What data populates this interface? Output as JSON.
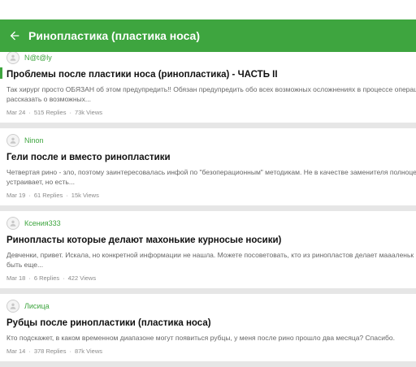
{
  "appbar": {
    "title": "Ринопластика (пластика носа)"
  },
  "posts": [
    {
      "author": "N@t@ly",
      "title": "Проблемы после пластики носа (ринопластика) - ЧАСТЬ II",
      "excerpt_line1": "Так хирург просто ОБЯЗАН об этом предупредить!! Обязан предупредить обо всех возможных осложнениях в процессе операц",
      "excerpt_line2": "рассказать о возможных...",
      "date": "Mar 24",
      "replies": "515 Replies",
      "views": "73k Views"
    },
    {
      "author": "Ninon",
      "title": "Гели после и вместо ринопластики",
      "excerpt_line1": "Четвертая рино - зло, поэтому заинтересовалась инфой по \"безоперационным\" методикам. Не в качестве заменителя полноце",
      "excerpt_line2": "устраивает, но есть...",
      "date": "Mar 19",
      "replies": "61 Replies",
      "views": "15k Views"
    },
    {
      "author": "Ксения333",
      "title": "Ринопласты которые делают махонькие курносые носики)",
      "excerpt_line1": "Девченки, привет. Искала, но конкретной информации не нашла. Можете посоветовать, кто из ринопластов делает маааленьк",
      "excerpt_line2": "быть еще...",
      "date": "Mar 18",
      "replies": "6 Replies",
      "views": "422 Views"
    },
    {
      "author": "Лисица",
      "title": "Рубцы после ринопластики (пластика носа)",
      "excerpt_line1": "Кто подскажет, в каком временном диапазоне могут появиться рубцы, у меня после рино прошло два месяца? Спасибо.",
      "excerpt_line2": "",
      "date": "Mar 14",
      "replies": "378 Replies",
      "views": "87k Views"
    }
  ]
}
